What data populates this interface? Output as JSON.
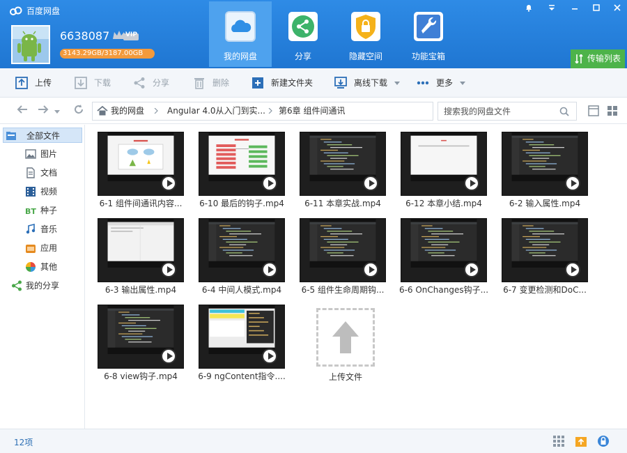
{
  "app": {
    "title": "百度网盘"
  },
  "user": {
    "name": "6638087",
    "vip_label": "VIP",
    "quota": "3143.29GB/3187.00GB"
  },
  "nav_tabs": [
    {
      "label": "我的网盘",
      "icon": "cloud-icon",
      "active": true
    },
    {
      "label": "分享",
      "icon": "share-icon",
      "active": false
    },
    {
      "label": "隐藏空间",
      "icon": "lock-icon",
      "active": false
    },
    {
      "label": "功能宝箱",
      "icon": "toolbox-icon",
      "active": false
    }
  ],
  "transfer": {
    "label": "传输列表"
  },
  "toolbar": {
    "upload": "上传",
    "download": "下载",
    "share": "分享",
    "delete": "删除",
    "new_folder": "新建文件夹",
    "offline_download": "离线下载",
    "more": "更多"
  },
  "breadcrumb": [
    "我的网盘",
    "Angular 4.0从入门到实...",
    "第6章 组件间通讯"
  ],
  "search": {
    "placeholder": "搜索我的网盘文件"
  },
  "sidebar": {
    "items": [
      {
        "label": "全部文件",
        "icon": "all-files-icon"
      },
      {
        "label": "图片",
        "icon": "image-icon"
      },
      {
        "label": "文档",
        "icon": "document-icon"
      },
      {
        "label": "视频",
        "icon": "video-icon"
      },
      {
        "label": "种子",
        "icon": "torrent-icon"
      },
      {
        "label": "音乐",
        "icon": "music-icon"
      },
      {
        "label": "应用",
        "icon": "app-icon"
      },
      {
        "label": "其他",
        "icon": "other-icon"
      },
      {
        "label": "我的分享",
        "icon": "my-share-icon"
      }
    ]
  },
  "files": [
    {
      "name": "6-1 组件间通讯内容...",
      "thumb": "slide"
    },
    {
      "name": "6-10 最后的钩子.mp4",
      "thumb": "diagram"
    },
    {
      "name": "6-11 本章实战.mp4",
      "thumb": "code"
    },
    {
      "name": "6-12 本章小结.mp4",
      "thumb": "white"
    },
    {
      "name": "6-2 输入属性.mp4",
      "thumb": "code"
    },
    {
      "name": "6-3 输出属性.mp4",
      "thumb": "browser"
    },
    {
      "name": "6-4 中间人模式.mp4",
      "thumb": "code"
    },
    {
      "name": "6-5 组件生命周期钩...",
      "thumb": "code"
    },
    {
      "name": "6-6 OnChanges钩子...",
      "thumb": "code"
    },
    {
      "name": "6-7 变更检测和DoC...",
      "thumb": "code"
    },
    {
      "name": "6-8 view钩子.mp4",
      "thumb": "code"
    },
    {
      "name": "6-9 ngContent指令....",
      "thumb": "colored"
    }
  ],
  "upload_tile": {
    "label": "上传文件"
  },
  "status": {
    "count": "12项"
  },
  "colors": {
    "header_blue": "#2a86e2",
    "active_tab": "#4ea2ee",
    "transfer_green": "#4db34a",
    "quota_orange": "#f39a3c"
  }
}
